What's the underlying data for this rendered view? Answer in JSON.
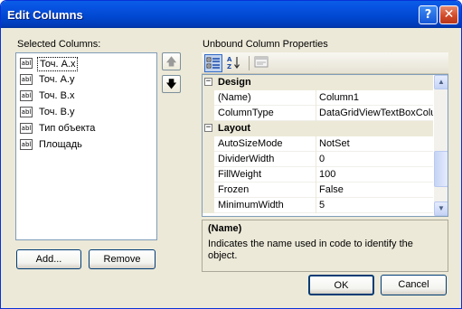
{
  "window": {
    "title": "Edit Columns",
    "help_symbol": "?",
    "close_symbol": "✕"
  },
  "left": {
    "label": "Selected Columns:",
    "columns": [
      {
        "icon": "abl",
        "label": "Точ. А.x",
        "selected": true
      },
      {
        "icon": "abl",
        "label": "Точ. А.y",
        "selected": false
      },
      {
        "icon": "abl",
        "label": "Точ. В.x",
        "selected": false
      },
      {
        "icon": "abl",
        "label": "Точ. В.y",
        "selected": false
      },
      {
        "icon": "abl",
        "label": "Тип объекта",
        "selected": false
      },
      {
        "icon": "abl",
        "label": "Площадь",
        "selected": false
      }
    ],
    "move_up_symbol": "🡅",
    "move_down_symbol": "🡇",
    "add_label": "Add...",
    "remove_label": "Remove"
  },
  "right": {
    "label": "Unbound Column Properties",
    "toolbar": {
      "categorized_icon": "categorized-icon",
      "alphabetical_icon": "alphabetical-icon",
      "property_pages_icon": "property-pages-icon"
    },
    "grid": {
      "categories": [
        {
          "name": "Design",
          "expander": "−",
          "rows": [
            {
              "name": "(Name)",
              "value": "Column1"
            },
            {
              "name": "ColumnType",
              "value": "DataGridViewTextBoxColumn"
            }
          ]
        },
        {
          "name": "Layout",
          "expander": "−",
          "rows": [
            {
              "name": "AutoSizeMode",
              "value": "NotSet"
            },
            {
              "name": "DividerWidth",
              "value": "0"
            },
            {
              "name": "FillWeight",
              "value": "100"
            },
            {
              "name": "Frozen",
              "value": "False"
            },
            {
              "name": "MinimumWidth",
              "value": "5"
            }
          ]
        }
      ],
      "scroll_up_symbol": "▲",
      "scroll_down_symbol": "▼"
    },
    "help": {
      "title": "(Name)",
      "description": "Indicates the name used in code to identify the object."
    }
  },
  "footer": {
    "ok_label": "OK",
    "cancel_label": "Cancel"
  },
  "colors": {
    "titlebar": "#0054e3",
    "dialog_bg": "#ece9d8",
    "list_border": "#7f9db9",
    "button_border": "#003c74"
  }
}
